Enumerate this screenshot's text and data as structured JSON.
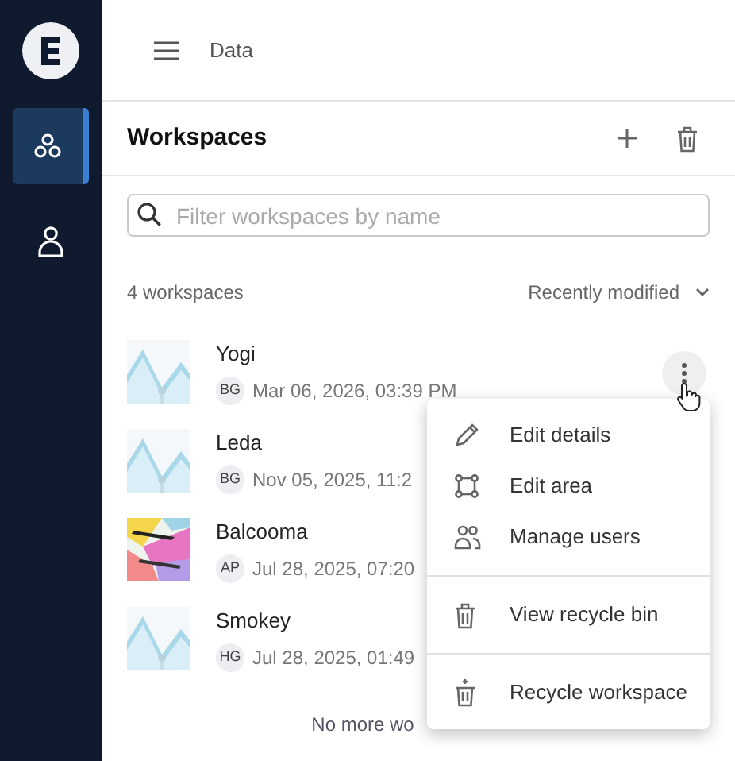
{
  "sidebar": {
    "items": [
      {
        "selected": true
      },
      {
        "selected": false
      }
    ]
  },
  "header": {
    "breadcrumb": "Data"
  },
  "panel": {
    "title": "Workspaces"
  },
  "search": {
    "placeholder": "Filter workspaces by name"
  },
  "summary": {
    "count": "4 workspaces",
    "sort": "Recently modified"
  },
  "workspaces": [
    {
      "name": "Yogi",
      "initials": "BG",
      "modified": "Mar 06, 2026, 03:39 PM",
      "menu_open": true
    },
    {
      "name": "Leda",
      "initials": "BG",
      "modified": "Nov 05, 2025, 11:2",
      "menu_open": false
    },
    {
      "name": "Balcooma",
      "initials": "AP",
      "modified": "Jul 28, 2025, 07:20",
      "menu_open": false
    },
    {
      "name": "Smokey",
      "initials": "HG",
      "modified": "Jul 28, 2025, 01:49",
      "menu_open": false
    }
  ],
  "footer": "No more wo",
  "menu": {
    "groups": [
      [
        "Edit details",
        "Edit area",
        "Manage users"
      ],
      [
        "View recycle bin"
      ],
      [
        "Recycle workspace"
      ]
    ]
  }
}
